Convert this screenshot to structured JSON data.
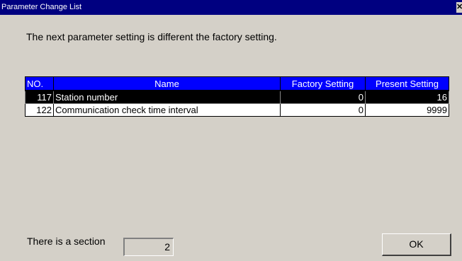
{
  "window": {
    "title": "Parameter Change List",
    "close_glyph": "✕"
  },
  "message": "The next parameter setting is different the factory setting.",
  "table": {
    "headers": {
      "no": "NO.",
      "name": "Name",
      "factory": "Factory Setting",
      "present": "Present Setting"
    },
    "rows": [
      {
        "no": "117",
        "name": "Station number",
        "factory": "0",
        "present": "16",
        "selected": true
      },
      {
        "no": "122",
        "name": "Communication check time interval",
        "factory": "0",
        "present": "9999",
        "selected": false
      }
    ]
  },
  "footer": {
    "label": "There is a section",
    "count": "2",
    "ok_label": "OK"
  },
  "colors": {
    "titlebar": "#000080",
    "header_bg": "#0000ff",
    "selected_row_bg": "#000000",
    "dialog_bg": "#d4d0c8"
  }
}
